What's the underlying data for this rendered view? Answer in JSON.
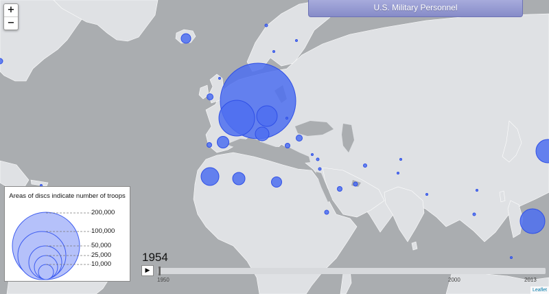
{
  "map": {
    "base_colors": {
      "land": "#dfe1e4",
      "water": "#aaadb0",
      "disc_fill": "#4d6ff0",
      "disc_stroke": "#2f4fe6"
    }
  },
  "zoom": {
    "in": "+",
    "out": "−"
  },
  "title": "U.S. Military Personnel",
  "legend": {
    "heading": "Areas of discs indicate number of troops",
    "levels": [
      {
        "label": "200,000",
        "troops": 200000
      },
      {
        "label": "100,000",
        "troops": 100000
      },
      {
        "label": "50,000",
        "troops": 50000
      },
      {
        "label": "25,000",
        "troops": 25000
      },
      {
        "label": "10,000",
        "troops": 10000
      }
    ]
  },
  "timeline": {
    "year": "1954",
    "play_icon": "play-icon",
    "play_glyph": "▶",
    "ticks": [
      "1950",
      "2000",
      "2013"
    ],
    "current_position": 0.0
  },
  "attribution": "Leaflet"
}
